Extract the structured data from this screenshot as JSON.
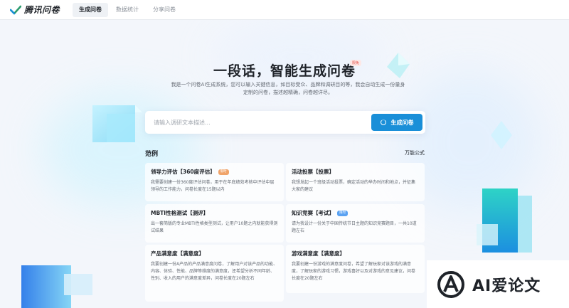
{
  "app": {
    "logo_text": "腾讯问卷"
  },
  "nav": {
    "tabs": [
      {
        "label": "生成问卷",
        "active": true
      },
      {
        "label": "数据统计",
        "active": false
      },
      {
        "label": "分享问卷",
        "active": false
      }
    ]
  },
  "hero": {
    "title": "一段话，智能生成问卷",
    "badge": "限免",
    "description": "我是一个问卷AI生成系统，您可以输入关键信息，如目标受众、品牌和调研目的等，我会自动生成一份量身定制的问卷，描述越精确，问卷越详尽。"
  },
  "search": {
    "placeholder": "请输入调研文本描述...",
    "value": "",
    "button_label": "生成问卷"
  },
  "examples": {
    "title": "范例",
    "formula_label": "万能公式",
    "cards": [
      {
        "title": "领导力评估【360度评估】",
        "tag": "限时",
        "tag_color": "#f0a46a",
        "desc": "我需要创建一份360度评估问卷，用于在年底绩效考核中评估中层领导的工作能力，问卷长度在15题以内"
      },
      {
        "title": "活动投票【投票】",
        "tag": "",
        "tag_color": "",
        "desc": "我想发起一个班级活动投票，确定活动的举办时间和地点，并征集大家的建议"
      },
      {
        "title": "MBTI性格测试【测评】",
        "tag": "",
        "tag_color": "",
        "desc": "出一套简版的专业MBTI性格类型测试，让用户10题之内就能获得测试结果"
      },
      {
        "title": "知识竞赛【考试】",
        "tag": "限时",
        "tag_color": "#5aa2f2",
        "desc": "请为我设计一份关于中国传统节日主题的知识竞赛题目，一共10道题左右"
      },
      {
        "title": "产品满意度【满意度】",
        "tag": "",
        "tag_color": "",
        "desc": "我要创建一份A产品的产品满意度问卷，了解用户对该产品的功能、内容、体验、性能、品牌等维度的满意度，还希望分析不同年龄、性别、收入的用户的满意度差异，问卷长度在20题左右"
      },
      {
        "title": "游戏满意度【满意度】",
        "tag": "",
        "tag_color": "",
        "desc": "我要创建一份游戏的满意度问卷，希望了解玩家对该游戏的满意度，了解玩家的游戏习惯，游戏喜好以及对游戏的意见建议，问卷长度在20题左右"
      }
    ]
  },
  "watermark": {
    "text": "AI爱论文"
  },
  "colors": {
    "accent": "#1a8fd8",
    "page_bg": "#f3f6fb"
  }
}
